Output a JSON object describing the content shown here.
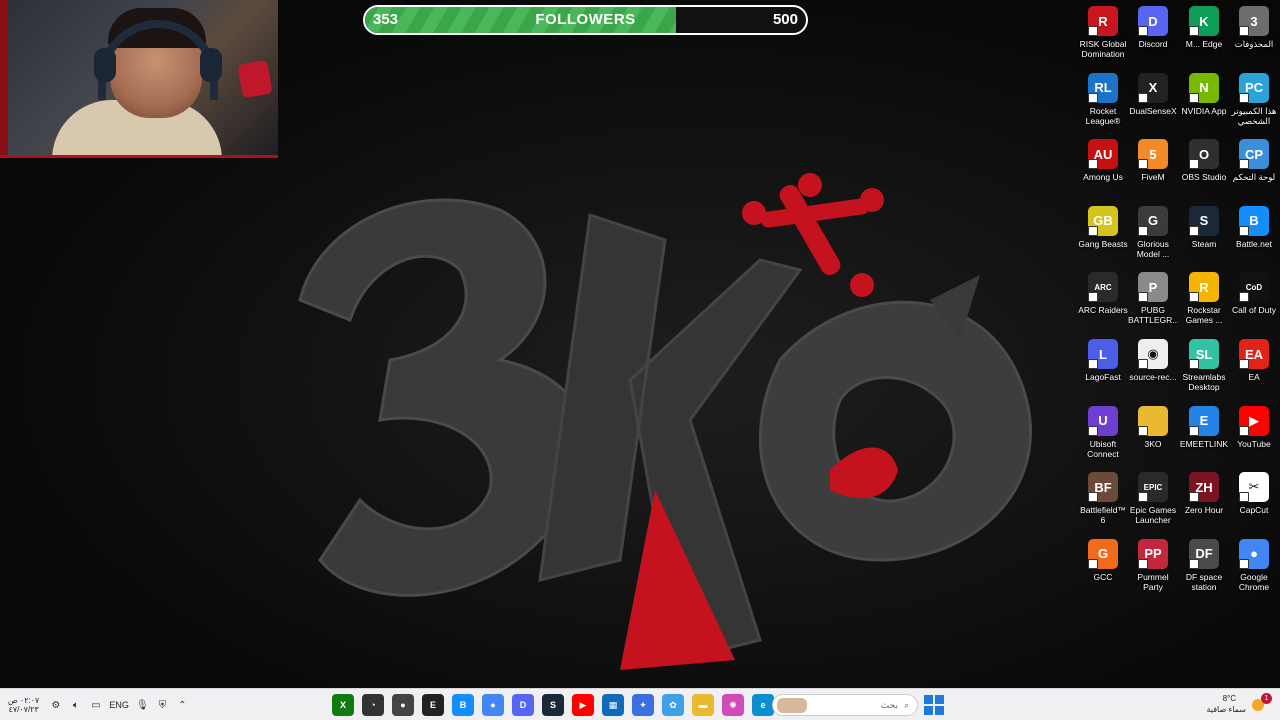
{
  "followers": {
    "current": "353",
    "title": "FOLLOWERS",
    "goal": "500",
    "progress": 0.706,
    "bar_color": "#3aa64a"
  },
  "webcam": {
    "accent_color": "#b0101a"
  },
  "wallpaper": {
    "logo_fill": "#3a3a3a",
    "accent_color": "#c4121f"
  },
  "desktop_icons": [
    {
      "label": "RISK Global Domination",
      "icon": "risk-icon",
      "color": "#c8161e",
      "glyph": "R"
    },
    {
      "label": "Discord",
      "icon": "discord-icon",
      "color": "#5865f2",
      "glyph": "D"
    },
    {
      "label": "M... Edge",
      "icon": "edge-icon",
      "color": "#0e9d58",
      "glyph": "K"
    },
    {
      "label": "المحذوفات",
      "icon": "recycle-bin-icon",
      "color": "#6d6d6d",
      "glyph": "3"
    },
    {
      "label": "Rocket League®",
      "icon": "rocket-league-icon",
      "color": "#1c74c9",
      "glyph": "RL"
    },
    {
      "label": "DualSenseX",
      "icon": "dualsensex-icon",
      "color": "#222222",
      "glyph": "X"
    },
    {
      "label": "NVIDIA App",
      "icon": "nvidia-icon",
      "color": "#76b900",
      "glyph": "N"
    },
    {
      "label": "هذا الكمبيوتر الشخصي",
      "icon": "this-pc-icon",
      "color": "#2ba3d9",
      "glyph": "PC"
    },
    {
      "label": "Among Us",
      "icon": "among-us-icon",
      "color": "#c51111",
      "glyph": "AU"
    },
    {
      "label": "FiveM",
      "icon": "fivem-icon",
      "color": "#f28a2a",
      "glyph": "5"
    },
    {
      "label": "OBS Studio",
      "icon": "obs-icon",
      "color": "#302e31",
      "glyph": "O"
    },
    {
      "label": "لوحة التحكم",
      "icon": "control-panel-icon",
      "color": "#3a8fd8",
      "glyph": "CP"
    },
    {
      "label": "Gang Beasts",
      "icon": "gang-beasts-icon",
      "color": "#d4c51c",
      "glyph": "GB"
    },
    {
      "label": "Glorious Model ...",
      "icon": "glorious-icon",
      "color": "#3b3b3b",
      "glyph": "G"
    },
    {
      "label": "Steam",
      "icon": "steam-icon",
      "color": "#1b2838",
      "glyph": "S"
    },
    {
      "label": "Battle.net",
      "icon": "battlenet-icon",
      "color": "#148eff",
      "glyph": "B"
    },
    {
      "label": "ARC Raiders",
      "icon": "arc-raiders-icon",
      "color": "#2a2a2a",
      "glyph": "ARC"
    },
    {
      "label": "PUBG BATTLEGR...",
      "icon": "pubg-icon",
      "color": "#8a8a8a",
      "glyph": "P"
    },
    {
      "label": "Rockstar Games ...",
      "icon": "rockstar-icon",
      "color": "#f4b400",
      "glyph": "R"
    },
    {
      "label": "Call of Duty",
      "icon": "call-of-duty-icon",
      "color": "#111111",
      "glyph": "CoD"
    },
    {
      "label": "LagoFast",
      "icon": "lagofast-icon",
      "color": "#4c5ee8",
      "glyph": "L"
    },
    {
      "label": "source-rec...",
      "icon": "source-record-icon",
      "color": "#eeeeee",
      "glyph": "◉"
    },
    {
      "label": "Streamlabs Desktop",
      "icon": "streamlabs-icon",
      "color": "#31c3a2",
      "glyph": "SL"
    },
    {
      "label": "EA",
      "icon": "ea-icon",
      "color": "#e2231a",
      "glyph": "EA"
    },
    {
      "label": "Ubisoft Connect",
      "icon": "ubisoft-icon",
      "color": "#6f3fd1",
      "glyph": "U"
    },
    {
      "label": "3KO",
      "icon": "folder-icon",
      "color": "#e8b931",
      "glyph": ""
    },
    {
      "label": "EMEETLINK",
      "icon": "emeetlink-icon",
      "color": "#2384e8",
      "glyph": "E"
    },
    {
      "label": "YouTube",
      "icon": "youtube-icon",
      "color": "#ff0000",
      "glyph": "▶"
    },
    {
      "label": "Battlefield™ 6",
      "icon": "battlefield-icon",
      "color": "#6b4a3a",
      "glyph": "BF"
    },
    {
      "label": "Epic Games Launcher",
      "icon": "epic-games-icon",
      "color": "#2a2a2a",
      "glyph": "EPIC"
    },
    {
      "label": "Zero Hour",
      "icon": "zero-hour-icon",
      "color": "#7a1420",
      "glyph": "ZH"
    },
    {
      "label": "CapCut",
      "icon": "capcut-icon",
      "color": "#ffffff",
      "glyph": "✂"
    },
    {
      "label": "GCC",
      "icon": "gcc-icon",
      "color": "#f26a1b",
      "glyph": "G"
    },
    {
      "label": "Pummel Party",
      "icon": "pummel-party-icon",
      "color": "#c2273b",
      "glyph": "PP"
    },
    {
      "label": "DF space station",
      "icon": "df-space-station-icon",
      "color": "#4a4a4a",
      "glyph": "DF"
    },
    {
      "label": "Google Chrome",
      "icon": "chrome-icon",
      "color": "#4285f4",
      "glyph": "●"
    }
  ],
  "taskbar": {
    "clock_time": "٠٢:٠٧ ص",
    "clock_date": "٤٧/٠٧/٢٣",
    "language": "ENG",
    "search_placeholder": "بحث",
    "weather_temp": "8°C",
    "weather_desc": "سماء صافية",
    "notification_count": "1",
    "tray_icons": [
      "settings-icon",
      "network-icon",
      "volume-icon",
      "display-icon",
      "microphone-icon",
      "security-icon",
      "chevron-up-icon"
    ],
    "apps": [
      {
        "icon": "xbox-icon",
        "color": "#107c10",
        "glyph": "X"
      },
      {
        "icon": "speedometer-icon",
        "color": "#333333",
        "glyph": "◔"
      },
      {
        "icon": "recorder-icon",
        "color": "#444444",
        "glyph": "●"
      },
      {
        "icon": "epic-taskbar-icon",
        "color": "#222222",
        "glyph": "E"
      },
      {
        "icon": "battlenet-taskbar-icon",
        "color": "#148eff",
        "glyph": "B"
      },
      {
        "icon": "chrome-taskbar-icon",
        "color": "#4285f4",
        "glyph": "●"
      },
      {
        "icon": "discord-taskbar-icon",
        "color": "#5865f2",
        "glyph": "D"
      },
      {
        "icon": "steam-taskbar-icon",
        "color": "#1b2838",
        "glyph": "S"
      },
      {
        "icon": "youtube-taskbar-icon",
        "color": "#ff0000",
        "glyph": "▶"
      },
      {
        "icon": "store-icon",
        "color": "#0f6cbd",
        "glyph": "▦"
      },
      {
        "icon": "copilot-icon",
        "color": "#3b6fe0",
        "glyph": "✦"
      },
      {
        "icon": "photos-icon",
        "color": "#3fa0e6",
        "glyph": "✿"
      },
      {
        "icon": "file-explorer-icon",
        "color": "#e8b931",
        "glyph": "▬"
      },
      {
        "icon": "pinwheel-icon",
        "color": "#d14bb8",
        "glyph": "✺"
      },
      {
        "icon": "edge-taskbar-icon",
        "color": "#0c8ecf",
        "glyph": "e"
      },
      {
        "icon": "terminal-icon",
        "color": "#2a2a2a",
        "glyph": "▪"
      }
    ]
  }
}
